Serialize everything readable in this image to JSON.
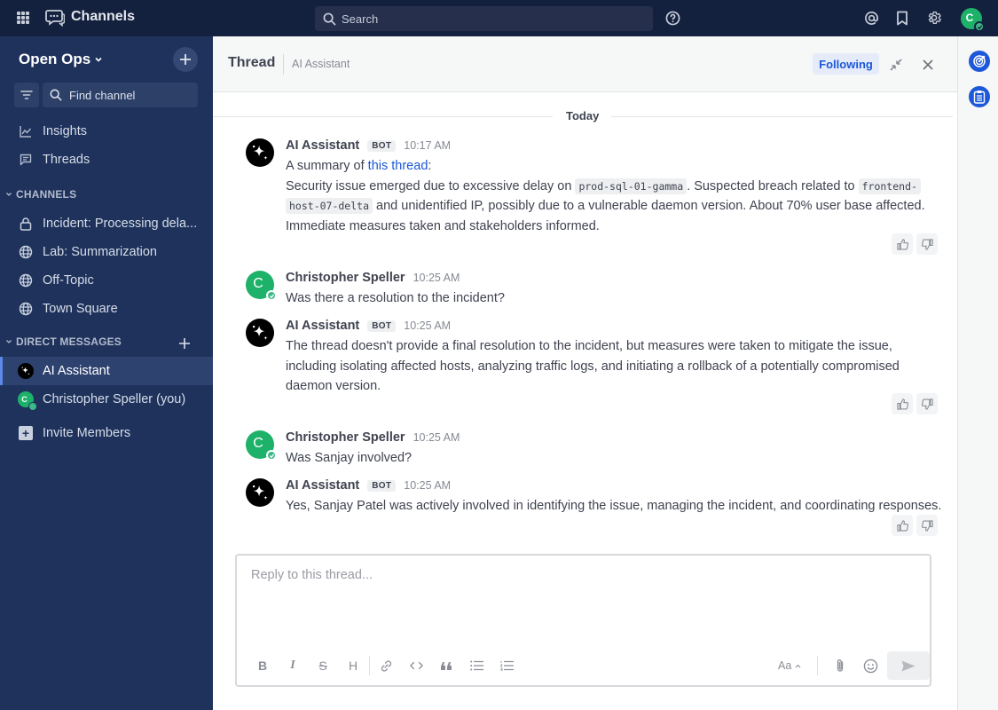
{
  "topbar": {
    "app_title": "Channels",
    "search_placeholder": "Search",
    "user_initial": "C",
    "icons": [
      "grid-icon",
      "channels-icon",
      "search-icon",
      "help-icon",
      "mention-icon",
      "bookmark-icon",
      "gear-icon"
    ]
  },
  "sidebar": {
    "team_name": "Open Ops",
    "find_channel": "Find channel",
    "nav": [
      {
        "label": "Insights",
        "icon": "chart-icon"
      },
      {
        "label": "Threads",
        "icon": "threads-icon"
      }
    ],
    "channels_header": "CHANNELS",
    "channels": [
      {
        "label": "Incident: Processing dela...",
        "icon": "lock-icon"
      },
      {
        "label": "Lab: Summarization",
        "icon": "globe-icon"
      },
      {
        "label": "Off-Topic",
        "icon": "globe-icon"
      },
      {
        "label": "Town Square",
        "icon": "globe-icon"
      }
    ],
    "dm_header": "DIRECT MESSAGES",
    "dms": [
      {
        "label": "AI Assistant",
        "active": true
      },
      {
        "label": "Christopher Speller (you)",
        "initial": "C"
      }
    ],
    "invite": "Invite Members"
  },
  "thread": {
    "title": "Thread",
    "subtitle": "AI Assistant",
    "following_label": "Following",
    "date_label": "Today",
    "messages": [
      {
        "author": "AI Assistant",
        "bot_tag": "BOT",
        "time": "10:17 AM",
        "intro_prefix": "A summary of ",
        "intro_link": "this thread",
        "intro_suffix": ":",
        "p1": "Security issue emerged due to excessive delay on ",
        "code1": "prod-sql-01-gamma",
        "p2": ". Suspected breach related to ",
        "code2a": "frontend-",
        "code2b": "host-07-delta",
        "p3": " and unidentified IP, possibly due to a vulnerable daemon version. About 70% user base affected. Immediate measures taken and stakeholders informed."
      },
      {
        "author": "Christopher Speller",
        "initial": "C",
        "time": "10:25 AM",
        "text": "Was there a resolution to the incident?"
      },
      {
        "author": "AI Assistant",
        "bot_tag": "BOT",
        "time": "10:25 AM",
        "text": "The thread doesn't provide a final resolution to the incident, but measures were taken to mitigate the issue, including isolating affected hosts, analyzing traffic logs, and initiating a rollback of a potentially compromised daemon version."
      },
      {
        "author": "Christopher Speller",
        "initial": "C",
        "time": "10:25 AM",
        "text": "Was Sanjay involved?"
      },
      {
        "author": "AI Assistant",
        "bot_tag": "BOT",
        "time": "10:25 AM",
        "text": "Yes, Sanjay Patel was actively involved in identifying the issue, managing the incident, and coordinating responses."
      }
    ],
    "reply": {
      "placeholder": "Reply to this thread...",
      "format_buttons": {
        "bold": "B",
        "italic": "I",
        "strike": "S",
        "heading": "H"
      },
      "text_size_label": "Aa"
    }
  },
  "colors": {
    "topbar_bg": "#14213e",
    "sidebar_bg": "#1e325c",
    "accent": "#1c58d9",
    "online": "#3db887",
    "user_avatar": "#1db169"
  }
}
